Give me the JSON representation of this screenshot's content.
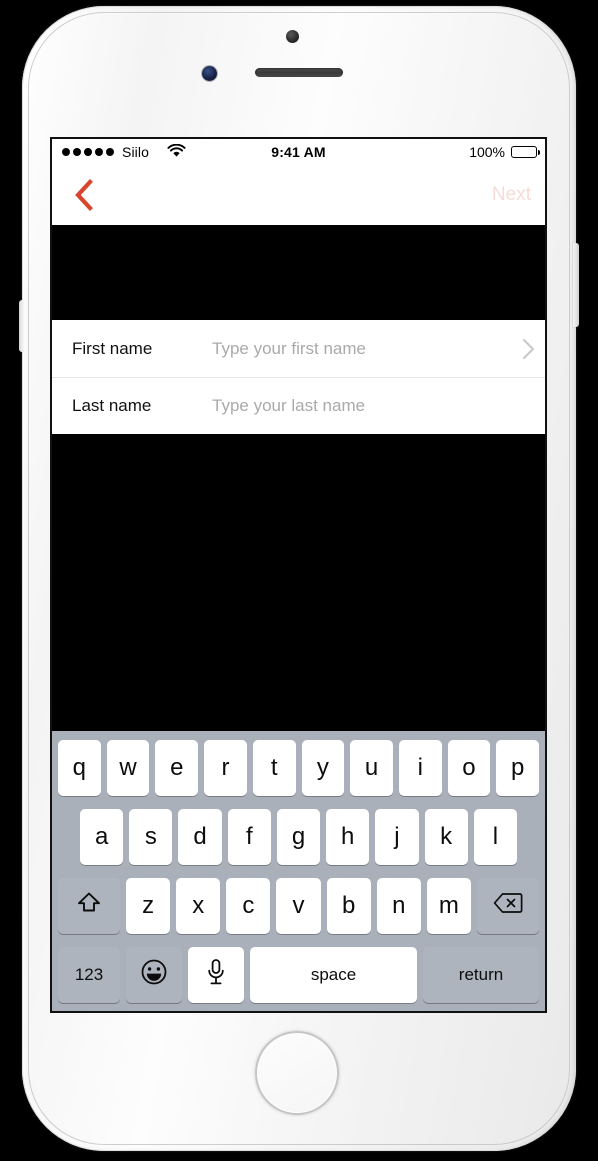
{
  "device": {
    "type": "smartphone-white",
    "icons": {
      "front_camera": "front-camera",
      "proximity_sensor": "proximity-sensor",
      "earpiece": "earpiece-speaker",
      "home_button": "home-button",
      "power_button": "power-button",
      "volume_button": "volume-button"
    }
  },
  "status_bar": {
    "signal_dots": 5,
    "carrier": "Siilo",
    "wifi_icon": "wifi-icon",
    "time": "9:41 AM",
    "battery_percent": "100%",
    "battery_level": 100
  },
  "nav_bar": {
    "back_icon": "chevron-left-icon",
    "back_color": "#d9452c",
    "next_label": "Next",
    "next_color": "#f6dcd6",
    "next_enabled": false
  },
  "form": {
    "rows": [
      {
        "label": "First name",
        "value": "",
        "placeholder": "Type your first name",
        "accessory": "chevron-right-icon"
      },
      {
        "label": "Last name",
        "value": "",
        "placeholder": "Type your last name",
        "accessory": ""
      }
    ]
  },
  "keyboard": {
    "background": "#aab0ba",
    "row1": [
      "q",
      "w",
      "e",
      "r",
      "t",
      "y",
      "u",
      "i",
      "o",
      "p"
    ],
    "row2": [
      "a",
      "s",
      "d",
      "f",
      "g",
      "h",
      "j",
      "k",
      "l"
    ],
    "row3": [
      "z",
      "x",
      "c",
      "v",
      "b",
      "n",
      "m"
    ],
    "shift_icon": "shift-arrow-icon",
    "backspace_icon": "backspace-delete-icon",
    "numbers_label": "123",
    "emoji_icon": "emoji-smiley-icon",
    "dictation_icon": "microphone-icon",
    "space_label": "space",
    "return_label": "return"
  }
}
